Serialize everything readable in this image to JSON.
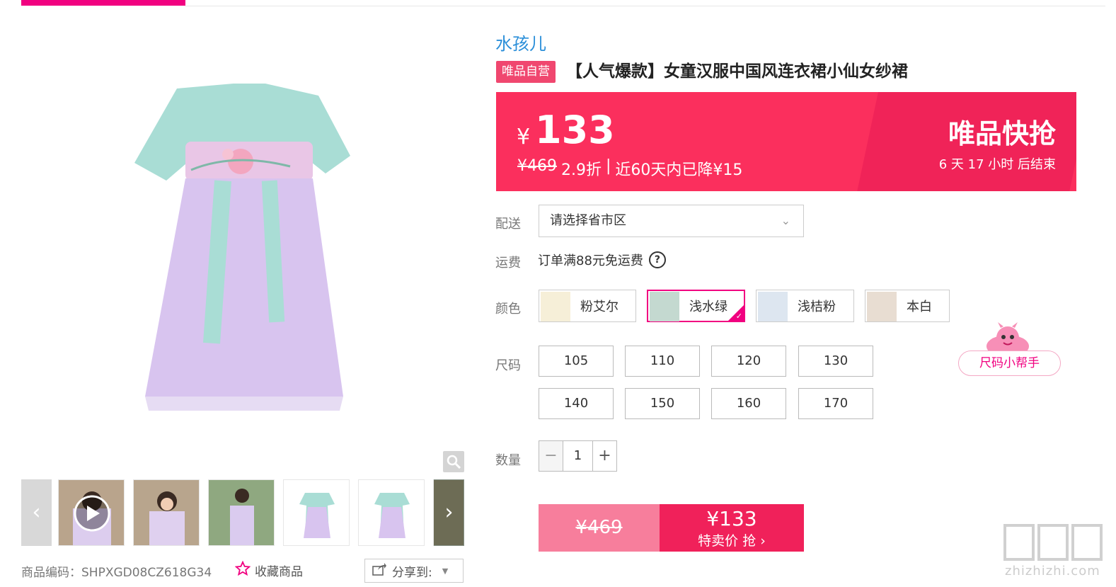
{
  "brand": "水孩儿",
  "product": {
    "badge": "唯品自营",
    "title": "【人气爆款】女童汉服中国风连衣裙小仙女纱裙",
    "sku_label": "商品编码：SHPXGD08CZ618G34",
    "favorite_label": "收藏商品",
    "share_label": "分享到:"
  },
  "price": {
    "currency": "¥",
    "current": "133",
    "original": "¥469",
    "discount": "2.9折",
    "separator": "|",
    "drop_note": "近60天内已降¥15",
    "flash_title": "唯品快抢",
    "countdown": "6 天 17 小时 后结束"
  },
  "delivery": {
    "label": "配送",
    "placeholder": "请选择省市区"
  },
  "freight": {
    "label": "运费",
    "text": "订单满88元免运费",
    "help": "?"
  },
  "colors": {
    "label": "颜色",
    "options": [
      "粉艾尔",
      "浅水绿",
      "浅桔粉",
      "本白"
    ],
    "selected": "浅水绿"
  },
  "sizes": {
    "label": "尺码",
    "options": [
      "105",
      "110",
      "120",
      "130",
      "140",
      "150",
      "160",
      "170"
    ],
    "helper": "尺码小帮手"
  },
  "quantity": {
    "label": "数量",
    "value": "1",
    "minus": "−",
    "plus": "+"
  },
  "buy": {
    "original": "¥469",
    "price": "¥133",
    "action": "特卖价 抢 ›"
  },
  "gallery": {
    "prev": "‹",
    "next": "›"
  },
  "watermark": {
    "logo": "值值值",
    "site": "zhizhizhi.com"
  },
  "colors_theme": {
    "accent": "#f10180",
    "price_band": "#fb2f5d",
    "brand_link": "#2b8fd9"
  }
}
